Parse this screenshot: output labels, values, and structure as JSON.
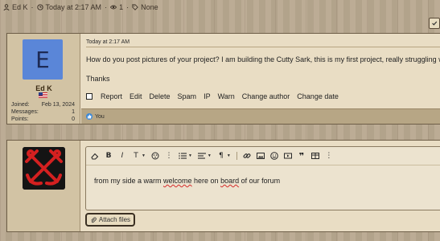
{
  "thread_meta": {
    "author": "Ed K",
    "date": "Today at 2:17 AM",
    "views": "1",
    "tags": "None"
  },
  "post": {
    "avatar_letter": "E",
    "username": "Ed K",
    "stats": [
      {
        "label": "Joined:",
        "value": "Feb 13, 2024"
      },
      {
        "label": "Messages:",
        "value": "1"
      },
      {
        "label": "Points:",
        "value": "0"
      }
    ],
    "timestamp": "Today at 2:17 AM",
    "body": "How do you post pictures of your project? I am building the Cutty Sark, this is my first project, really struggling with th",
    "signoff": "Thanks",
    "actions": [
      "Report",
      "Edit",
      "Delete",
      "Spam",
      "IP",
      "Warn",
      "Change author",
      "Change date"
    ],
    "reaction": "You"
  },
  "reply": {
    "draft_text_parts": [
      {
        "text": "from my side a warm ",
        "flag": false
      },
      {
        "text": "welcome",
        "flag": true
      },
      {
        "text": " here on ",
        "flag": false
      },
      {
        "text": "board",
        "flag": true
      },
      {
        "text": " of our forum",
        "flag": false
      }
    ],
    "attach_label": "Attach files"
  },
  "colors": {
    "avatar_bg": "#5a86d8",
    "like_blue": "#3d8ad8",
    "anchor_red": "#d42020"
  }
}
